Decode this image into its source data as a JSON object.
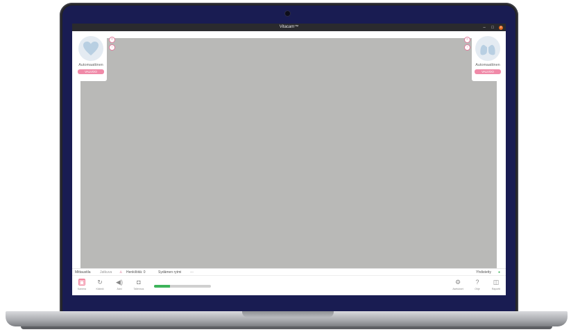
{
  "window": {
    "title": "Vitacam™"
  },
  "panels": {
    "left": {
      "label": "Automaattinen",
      "badge": "VALVOO",
      "icon": "heart-icon"
    },
    "right": {
      "label": "Automaattinen",
      "badge": "VALVOO",
      "icon": "lungs-icon"
    }
  },
  "status": {
    "mode_label": "Mittaustila",
    "mode_value": "Jatkuva",
    "person_icon": "person-icon",
    "subjects": "Henkilöitä: 0",
    "heart_rhythm": "Sydämen rytmi",
    "heart_value": "---",
    "connection": "Yhdistetty"
  },
  "toolbar": {
    "items": [
      {
        "label": "Kamera",
        "icon": "camera-icon"
      },
      {
        "label": "Kääntö",
        "icon": "rotate-icon"
      },
      {
        "label": "Ääni",
        "icon": "speaker-icon"
      },
      {
        "label": "Tallennus",
        "icon": "record-icon"
      }
    ],
    "right_items": [
      {
        "label": "Asetukset",
        "icon": "gear-icon"
      },
      {
        "label": "Ohje",
        "icon": "help-icon"
      },
      {
        "label": "Raportti",
        "icon": "report-icon"
      }
    ],
    "progress_fraction": 0.28
  },
  "colors": {
    "accent": "#f2859f",
    "bezel": "#191c52",
    "canvas": "#b9b9b7",
    "progress": "#3db35a"
  }
}
